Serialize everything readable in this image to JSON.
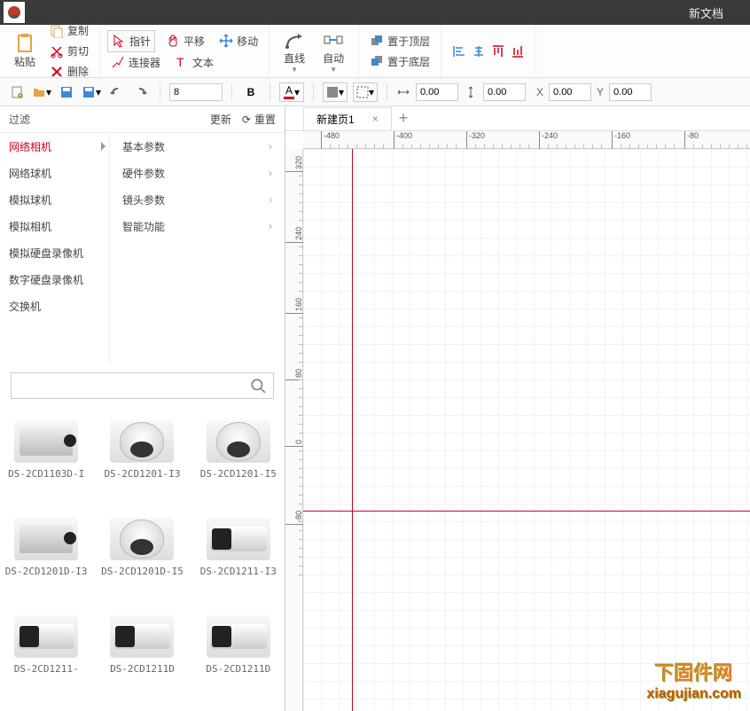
{
  "title": "新文档",
  "ribbon": {
    "paste": "粘贴",
    "copy": "复制",
    "cut": "剪切",
    "delete": "删除",
    "pointer": "指针",
    "connector": "连接器",
    "pan": "平移",
    "text": "文本",
    "move": "移动",
    "line": "直线",
    "auto": "自动",
    "bring_front": "置于顶层",
    "send_back": "置于底层"
  },
  "toolbar": {
    "font_size": "8",
    "x_val": "0.00",
    "y_val": "0.00",
    "w_val": "0.00",
    "h_val": "0.00",
    "x_label": "X",
    "y_label": "Y"
  },
  "filter": {
    "label": "过滤",
    "update": "更新",
    "reset": "重置"
  },
  "categories": [
    "网络相机",
    "网络球机",
    "模拟球机",
    "模拟相机",
    "模拟硬盘录像机",
    "数字硬盘录像机",
    "交换机"
  ],
  "subcategories": [
    "基本参数",
    "硬件参数",
    "镜头参数",
    "智能功能"
  ],
  "search_placeholder": "",
  "products": [
    {
      "name": "DS-2CD1103D-I",
      "type": "box"
    },
    {
      "name": "DS-2CD1201-I3",
      "type": "dome"
    },
    {
      "name": "DS-2CD1201-I5",
      "type": "dome"
    },
    {
      "name": "DS-2CD1201D-I3",
      "type": "box"
    },
    {
      "name": "DS-2CD1201D-I5",
      "type": "dome"
    },
    {
      "name": "DS-2CD1211-I3",
      "type": "bullet"
    },
    {
      "name": "DS-2CD1211-",
      "type": "bullet"
    },
    {
      "name": "DS-2CD1211D",
      "type": "bullet"
    },
    {
      "name": "DS-2CD1211D",
      "type": "bullet"
    }
  ],
  "tab_name": "新建页1",
  "ruler_h": [
    "-480",
    "-400",
    "-320",
    "-240",
    "-160",
    "-80"
  ],
  "ruler_v": [
    "320",
    "240",
    "160",
    "80",
    "0",
    "-80"
  ],
  "watermark": {
    "line1": "下固件网",
    "line2": "xiagujian.com"
  }
}
